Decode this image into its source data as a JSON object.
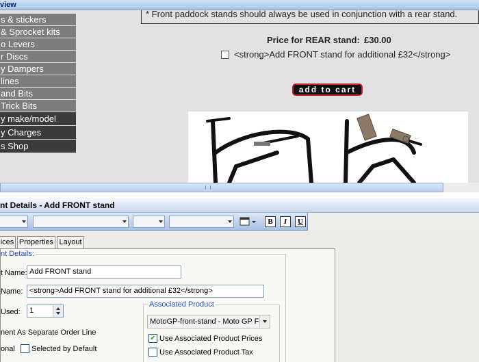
{
  "preview": {
    "title": "view",
    "menu_items": [
      "s & stickers",
      "& Sprocket kits",
      "o Levers",
      "r Discs",
      "y Dampers",
      "lines",
      "and Bits",
      "Trick Bits",
      "y make/model",
      "y Charges",
      "s Shop"
    ],
    "note": "* Front paddock stands should always be used in conjunction with a rear stand.",
    "price_label": "Price for REAR stand:",
    "price_value": "£30.00",
    "front_option_label": "<strong>Add FRONT stand for additional £32</strong>",
    "front_option_checked": false,
    "add_to_cart": "add to cart"
  },
  "dialog": {
    "title": "nt Details - Add FRONT stand",
    "tabs": [
      "ices",
      "Properties",
      "Layout"
    ],
    "group_title": "nt Details:",
    "name_label": "t Name:",
    "name_value": "Add FRONT stand",
    "display_label": "Name:",
    "display_value": "<strong>Add FRONT stand for additional £32</strong>",
    "used_label": "Used:",
    "used_value": "1",
    "separate_line_label": "nent As Separate Order Line",
    "optional_label": "onal",
    "selected_default_label": "Selected by Default",
    "selected_default_checked": false,
    "associated": {
      "title": "Associated Product",
      "product_value": "MotoGP-front-stand -     Moto GP Fr",
      "use_prices_label": "Use Associated Product Prices",
      "use_prices_checked": true,
      "use_tax_label": "Use Associated Product Tax",
      "use_tax_checked": false
    },
    "format_buttons": [
      "B",
      "I",
      "U"
    ]
  }
}
